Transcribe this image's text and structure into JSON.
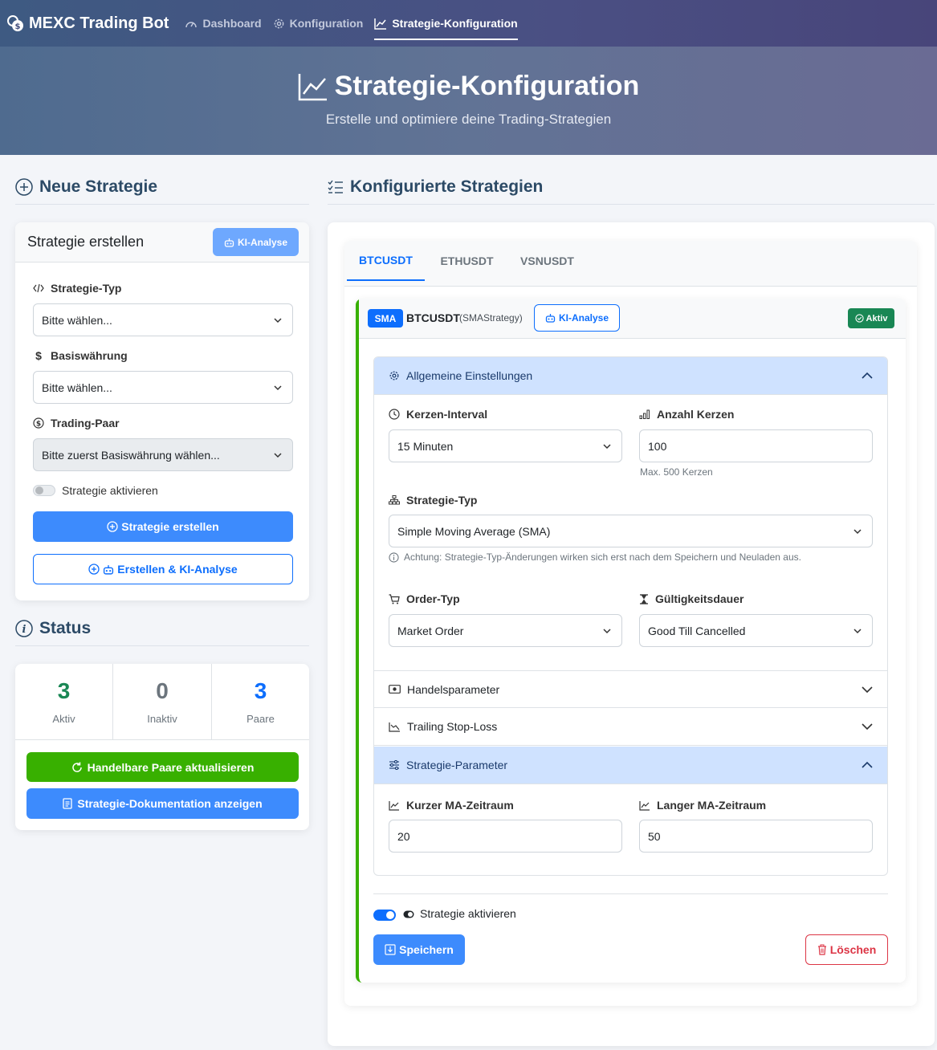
{
  "nav": {
    "brand": "MEXC Trading Bot",
    "items": [
      {
        "label": "Dashboard"
      },
      {
        "label": "Konfiguration"
      },
      {
        "label": "Strategie-Konfiguration"
      }
    ]
  },
  "hero": {
    "title": "Strategie-Konfiguration",
    "subtitle": "Erstelle und optimiere deine Trading-Strategien"
  },
  "new_strategy": {
    "heading": "Neue Strategie",
    "card_title": "Strategie erstellen",
    "ki_button": "KI-Analyse",
    "type_label": "Strategie-Typ",
    "type_value": "Bitte wählen...",
    "base_label": "Basiswährung",
    "base_value": "Bitte wählen...",
    "pair_label": "Trading-Paar",
    "pair_value": "Bitte zuerst Basiswährung wählen...",
    "activate_label": "Strategie aktivieren",
    "create_button": "Strategie erstellen",
    "create_ki_button": "Erstellen & KI-Analyse"
  },
  "status": {
    "heading": "Status",
    "stats": [
      {
        "value": "3",
        "label": "Aktiv",
        "color": "#198754"
      },
      {
        "value": "0",
        "label": "Inaktiv",
        "color": "#6c757d"
      },
      {
        "value": "3",
        "label": "Paare",
        "color": "#0d6efd"
      }
    ],
    "refresh_button": "Handelbare Paare aktualisieren",
    "docs_button": "Strategie-Dokumentation anzeigen"
  },
  "configured": {
    "heading": "Konfigurierte Strategien",
    "tabs": [
      {
        "label": "BTCUSDT"
      },
      {
        "label": "ETHUSDT"
      },
      {
        "label": "VSNUSDT"
      }
    ],
    "strategy": {
      "badge": "SMA",
      "pair": "BTCUSDT",
      "class_name": "(SMAStrategy)",
      "ki_button": "KI-Analyse",
      "status": "Aktiv",
      "general": {
        "title": "Allgemeine Einstellungen",
        "interval_label": "Kerzen-Interval",
        "interval_value": "15 Minuten",
        "count_label": "Anzahl Kerzen",
        "count_value": "100",
        "count_hint": "Max. 500 Kerzen",
        "type_label": "Strategie-Typ",
        "type_value": "Simple Moving Average (SMA)",
        "type_note": "Achtung: Strategie-Typ-Änderungen wirken sich erst nach dem Speichern und Neuladen aus.",
        "order_label": "Order-Typ",
        "order_value": "Market Order",
        "validity_label": "Gültigkeitsdauer",
        "validity_value": "Good Till Cancelled"
      },
      "trade_params": "Handelsparameter",
      "trailing": "Trailing Stop-Loss",
      "strategy_params": {
        "title": "Strategie-Parameter",
        "short_label": "Kurzer MA-Zeitraum",
        "short_value": "20",
        "long_label": "Langer MA-Zeitraum",
        "long_value": "50"
      },
      "activate_label": "Strategie aktivieren",
      "save_button": "Speichern",
      "delete_button": "Löschen"
    }
  }
}
